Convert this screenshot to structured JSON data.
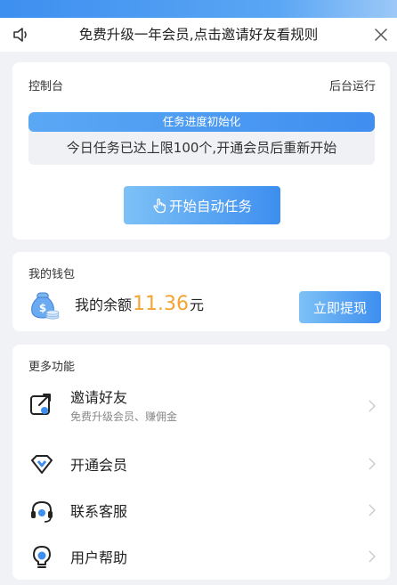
{
  "notice": {
    "text": "免费升级一年会员,点击邀请好友看规则",
    "speaker_icon": "speaker-icon",
    "close_icon": "close-icon"
  },
  "console": {
    "title": "控制台",
    "right_label": "后台运行",
    "progress_title": "任务进度初始化",
    "progress_message": "今日任务已达上限100个,开通会员后重新开始",
    "start_button": "开始自动任务",
    "start_icon": "hand-pointer-icon"
  },
  "wallet": {
    "title": "我的钱包",
    "balance_prefix": "我的余额",
    "amount": "11.36",
    "unit": "元",
    "withdraw_button": "立即提现",
    "icon": "money-bag-icon"
  },
  "more": {
    "title": "更多功能",
    "items": [
      {
        "label": "邀请好友",
        "sub": "免费升级会员、赚佣金",
        "icon": "share-icon"
      },
      {
        "label": "开通会员",
        "icon": "diamond-icon"
      },
      {
        "label": "联系客服",
        "icon": "headset-icon"
      },
      {
        "label": "用户帮助",
        "icon": "lightbulb-icon"
      }
    ]
  },
  "colors": {
    "accent_blue": "#3d8ef0",
    "amount_orange": "#f5a431",
    "background": "#f1f2f6"
  }
}
